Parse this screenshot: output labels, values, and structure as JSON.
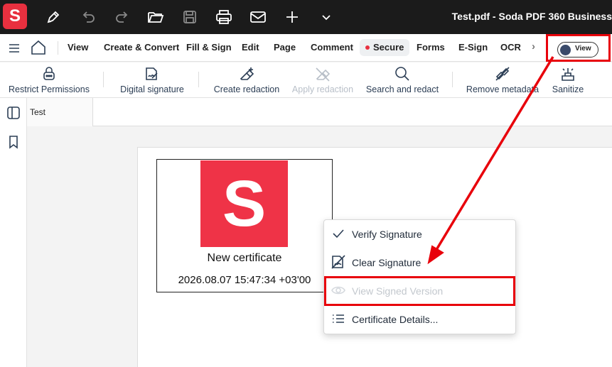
{
  "titlebar": {
    "logo_letter": "S",
    "document_title": "Test.pdf  -  Soda PDF 360 Business",
    "icons": [
      "pen-icon",
      "undo-icon",
      "redo-icon",
      "open-folder-icon",
      "save-icon",
      "print-icon",
      "mail-icon",
      "plus-icon",
      "chevron-down-icon"
    ]
  },
  "menubar": {
    "items": [
      "View",
      "Create & Convert",
      "Fill & Sign",
      "Edit",
      "Page",
      "Comment",
      "Secure",
      "Forms",
      "E-Sign",
      "OCR"
    ],
    "active": "Secure",
    "more": "›",
    "view_toggle_label": "View"
  },
  "ribbon": {
    "buttons": [
      {
        "label": "Restrict Permissions",
        "icon": "lock-icon",
        "enabled": true
      },
      {
        "label": "Digital signature",
        "icon": "signature-icon",
        "enabled": true
      },
      {
        "label": "Create redaction",
        "icon": "create-redaction-icon",
        "enabled": true
      },
      {
        "label": "Apply redaction",
        "icon": "apply-redaction-icon",
        "enabled": false
      },
      {
        "label": "Search and redact",
        "icon": "search-icon",
        "enabled": true
      },
      {
        "label": "Remove metadata",
        "icon": "remove-metadata-icon",
        "enabled": true
      },
      {
        "label": "Sanitize",
        "icon": "sanitize-icon",
        "enabled": true
      }
    ]
  },
  "document_tab": {
    "label": "Test"
  },
  "signature": {
    "logo_letter": "S",
    "name": "New certificate",
    "timestamp": "2026.08.07 15:47:34 +03'00"
  },
  "context_menu": {
    "items": [
      {
        "label": "Verify Signature",
        "icon": "check-icon",
        "enabled": true
      },
      {
        "label": "Clear Signature",
        "icon": "clear-signature-icon",
        "enabled": true
      },
      {
        "label": "View Signed Version",
        "icon": "eye-icon",
        "enabled": false
      },
      {
        "label": "Certificate Details...",
        "icon": "list-icon",
        "enabled": true
      }
    ]
  },
  "colors": {
    "titlebar_bg": "#1b1b1b",
    "brand_red": "#e8303f",
    "annotation_red": "#e8000b",
    "icon_navy": "#2c3e55"
  }
}
